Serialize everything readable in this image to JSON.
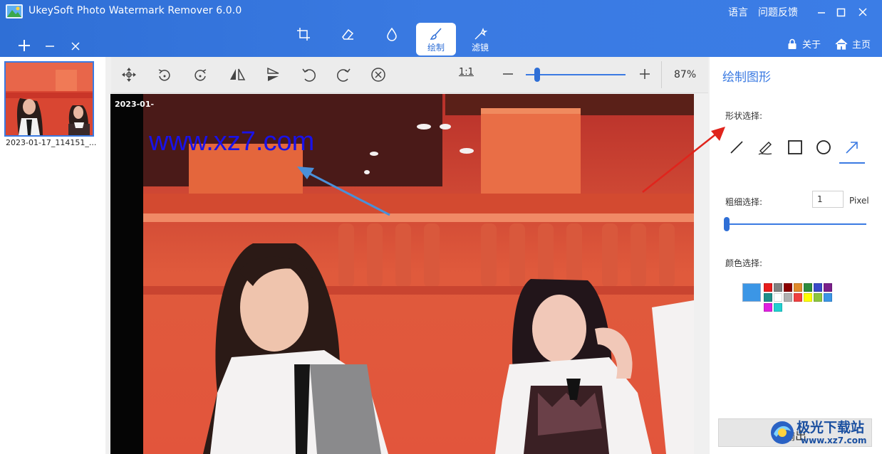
{
  "window": {
    "title": "UkeySoft Photo Watermark Remover 6.0.0",
    "top_links": [
      "语言",
      "问题反馈"
    ]
  },
  "toolbar": {
    "tools": [
      {
        "name": "crop",
        "label": ""
      },
      {
        "name": "eraser",
        "label": ""
      },
      {
        "name": "drop",
        "label": ""
      },
      {
        "name": "draw",
        "label": "绘制"
      },
      {
        "name": "filter",
        "label": "滤镜"
      }
    ],
    "active_tool": "draw",
    "about_label": "关于",
    "home_label": "主页"
  },
  "files": [
    {
      "caption": "2023-01-17_114151_..."
    }
  ],
  "canvas": {
    "ratio_label": "1:1",
    "zoom_label": "87%",
    "zoom_fraction": 0.08,
    "date_stamp": "2023-01-",
    "watermark_text": "www.xz7.com"
  },
  "panel": {
    "title": "绘制图形",
    "shape_label": "形状选择:",
    "shapes": [
      "line-icon",
      "pen-icon",
      "rectangle-icon",
      "circle-icon",
      "arrow-icon"
    ],
    "active_shape": "arrow-icon",
    "thickness_label": "粗细选择:",
    "thickness_value": "1",
    "thickness_unit": "Pixel",
    "color_label": "颜色选择:",
    "current_color": "#3b96e6",
    "palette": [
      "#e81c1c",
      "#808080",
      "#8b0000",
      "#e08a2a",
      "#2e8b3e",
      "#3a4ac8",
      "#7a1f8a",
      "#1f8f8a",
      "#ffffff",
      "#b0b0b0",
      "#f04040",
      "#ffff00",
      "#8cc63f",
      "#3b96e6",
      "#e020e0",
      "#20d0d0"
    ],
    "export_label": "输出"
  },
  "corner_logo": {
    "text_main": "极光下载站",
    "text_sub": "www.xz7.com"
  }
}
